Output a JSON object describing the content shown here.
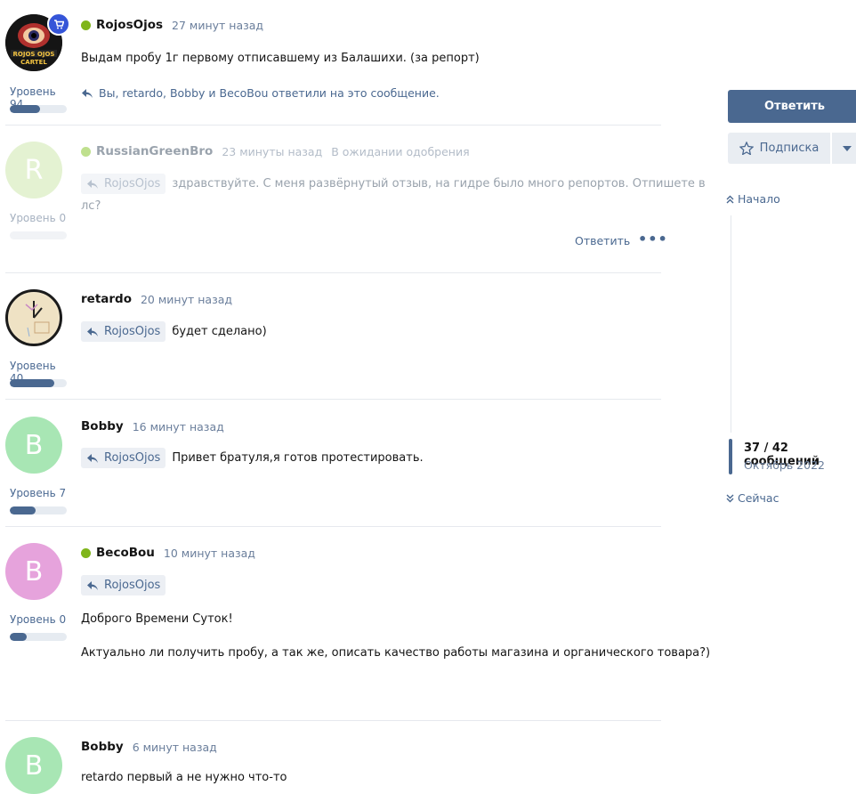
{
  "posts": [
    {
      "username": "RojosOjos",
      "time": "27 минут назад",
      "level": "Уровень 94",
      "level_fraction": 0.53,
      "online": true,
      "text": "Выдам пробу 1г первому отписавшему из Балашихи. (за репорт)",
      "reactions": "Вы, retardo, Bobby и BecoBou ответили на это сообщение.",
      "avatar_text": "ROJOS OJOS CARTEL"
    },
    {
      "username": "RussianGreenBro",
      "time": "23 минуты назад",
      "status": "В ожидании одобрения",
      "level": "Уровень 0",
      "level_fraction": 0.0,
      "avatar_letter": "R",
      "quote": "RojosOjos",
      "text_line1": "здравствуйте. С меня развёрнутый отзыв, на гидре было много репортов. Отпишете в",
      "text_line2": "лс?",
      "reply_label": "Ответить",
      "more_label": "•••"
    },
    {
      "username": "retardo",
      "time": "20 минут назад",
      "level": "Уровень 40",
      "level_fraction": 0.78,
      "quote": "RojosOjos",
      "text": "будет сделано)"
    },
    {
      "username": "Bobby",
      "time": "16 минут назад",
      "level": "Уровень 7",
      "level_fraction": 0.45,
      "avatar_letter": "B",
      "quote": "RojosOjos",
      "text": "Привет братуля,я готов протестировать."
    },
    {
      "username": "BecoBou",
      "time": "10 минут назад",
      "level": "Уровень 0",
      "level_fraction": 0.3,
      "avatar_letter": "B",
      "online": true,
      "quote": "RojosOjos",
      "text_line1": "Доброго Времени Суток!",
      "text_line2": "Актуально ли получить пробу, а так же, описать качество работы магазина и органического товара?)"
    },
    {
      "username": "Bobby",
      "time": "6 минут назад",
      "avatar_letter": "B",
      "text_partial": "retardo первый а не нужно что-то"
    }
  ],
  "sidebar": {
    "reply_button": "Ответить",
    "subscribe_button": "Подписка",
    "nav_start": "Начало",
    "position_count": "37 / 42 сообщений",
    "position_date": "Октябрь 2022",
    "nav_now": "Сейчас"
  },
  "colors": {
    "accent": "#4a6890",
    "online": "#7fb51b",
    "avatar_R": "#e4f2d2",
    "avatar_B_green": "#a8e6b4",
    "avatar_B_pink": "#e6a3dc"
  }
}
